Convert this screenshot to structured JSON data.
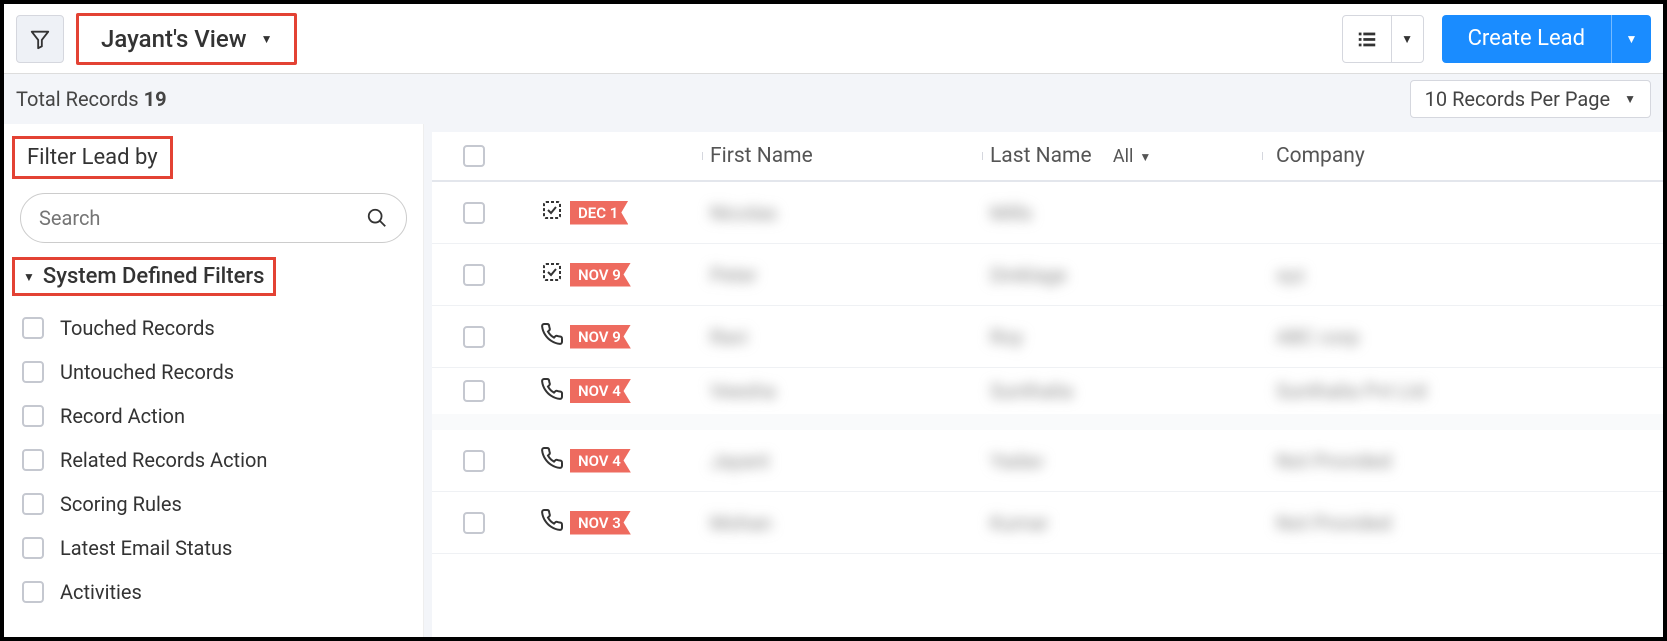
{
  "header": {
    "view_name": "Jayant's View",
    "create_label": "Create Lead"
  },
  "subheader": {
    "total_label": "Total Records",
    "total_count": "19",
    "per_page_label": "10 Records Per Page"
  },
  "sidebar": {
    "title": "Filter Lead by",
    "search_placeholder": "Search",
    "system_filters_label": "System Defined Filters",
    "filters": [
      "Touched Records",
      "Untouched Records",
      "Record Action",
      "Related Records Action",
      "Scoring Rules",
      "Latest Email Status",
      "Activities"
    ]
  },
  "table": {
    "columns": {
      "first_name": "First Name",
      "last_name": "Last Name",
      "last_name_dd": "All",
      "company": "Company"
    },
    "rows": [
      {
        "icon": "task",
        "date": "DEC 1",
        "fn": "Nicolas",
        "ln": "Mills",
        "co": ""
      },
      {
        "icon": "task",
        "date": "NOV 9",
        "fn": "Peter",
        "ln": "Dinklage",
        "co": "xyz"
      },
      {
        "icon": "call",
        "date": "NOV 9",
        "fn": "Ravi",
        "ln": "Roy",
        "co": "ABC corp"
      },
      {
        "icon": "call",
        "date": "NOV 4",
        "fn": "Veesha",
        "ln": "Sunthalia",
        "co": "Sunthalia Pvt Ltd"
      },
      {
        "icon": "call",
        "date": "NOV 4",
        "fn": "Jayant",
        "ln": "Yadav",
        "co": "Not Provided"
      },
      {
        "icon": "call",
        "date": "NOV 3",
        "fn": "Mohan",
        "ln": "Kumar",
        "co": "Not Provided"
      }
    ]
  }
}
